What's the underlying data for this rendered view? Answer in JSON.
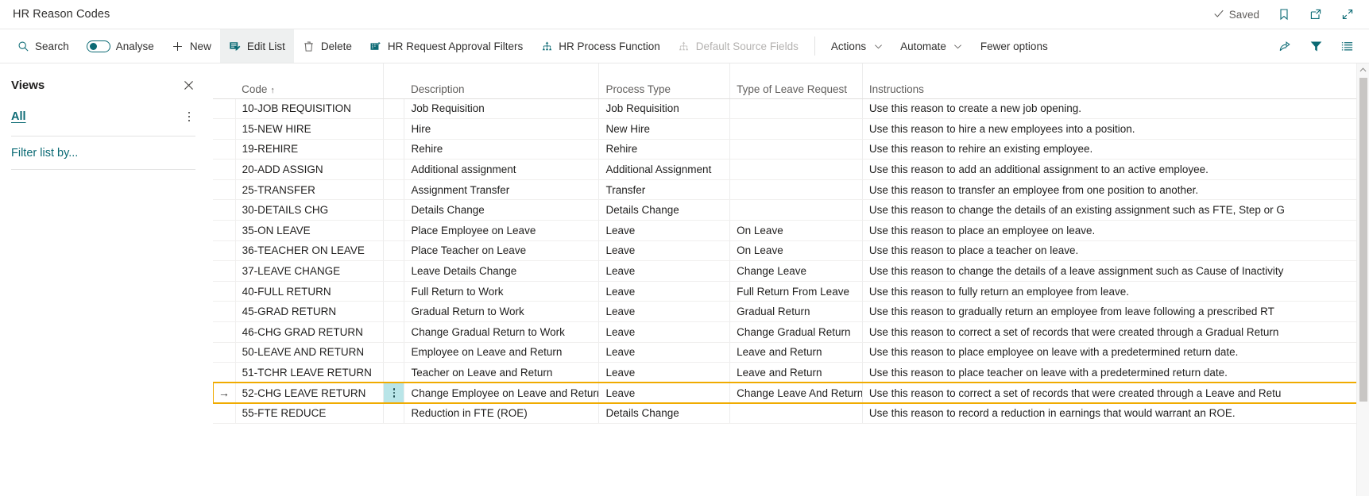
{
  "window": {
    "title": "HR Reason Codes",
    "save_status": "Saved",
    "icons": {
      "check": "check-icon",
      "bookmark": "bookmark-icon",
      "open_in_new": "open-in-new-window-icon",
      "collapse": "collapse-icon"
    }
  },
  "toolbar": {
    "search_label": "Search",
    "analyse_label": "Analyse",
    "analyse_on": true,
    "new_label": "New",
    "edit_list_label": "Edit List",
    "delete_label": "Delete",
    "hr_request_approval_filters_label": "HR Request Approval Filters",
    "hr_process_function_label": "HR Process Function",
    "default_source_fields_label": "Default Source Fields",
    "default_source_fields_disabled": true,
    "actions_label": "Actions",
    "automate_label": "Automate",
    "fewer_options_label": "Fewer options",
    "right_icons": {
      "share": "share-icon",
      "filter": "filter-icon",
      "list": "list-view-icon"
    }
  },
  "views_pane": {
    "title": "Views",
    "close_icon": "close-icon",
    "active_view": "All",
    "more_icon": "more-options-icon",
    "filter_placeholder": "Filter list by..."
  },
  "grid": {
    "columns": [
      {
        "key": "code",
        "label": "Code",
        "sort": "↑"
      },
      {
        "key": "description",
        "label": "Description",
        "sort": ""
      },
      {
        "key": "process_type",
        "label": "Process Type",
        "sort": ""
      },
      {
        "key": "type_of_leave_request",
        "label": "Type of Leave Request",
        "sort": ""
      },
      {
        "key": "instructions",
        "label": "Instructions",
        "sort": ""
      }
    ],
    "selected_row_index": 14,
    "selected_row_indicator": "→",
    "row_menu_icon": "row-options-icon",
    "rows": [
      {
        "code": "10-JOB REQUISITION",
        "description": "Job Requisition",
        "process_type": "Job Requisition",
        "type_of_leave_request": "",
        "instructions": "Use this reason to create a new job opening."
      },
      {
        "code": "15-NEW HIRE",
        "description": "Hire",
        "process_type": "New Hire",
        "type_of_leave_request": "",
        "instructions": "Use this reason to hire a new employees into a position."
      },
      {
        "code": "19-REHIRE",
        "description": "Rehire",
        "process_type": "Rehire",
        "type_of_leave_request": "",
        "instructions": "Use this reason to rehire an existing employee."
      },
      {
        "code": "20-ADD ASSIGN",
        "description": "Additional assignment",
        "process_type": "Additional Assignment",
        "type_of_leave_request": "",
        "instructions": "Use this reason to add an additional assignment to an active employee."
      },
      {
        "code": "25-TRANSFER",
        "description": "Assignment Transfer",
        "process_type": "Transfer",
        "type_of_leave_request": "",
        "instructions": "Use this reason to transfer an employee from one position to another."
      },
      {
        "code": "30-DETAILS CHG",
        "description": "Details Change",
        "process_type": "Details Change",
        "type_of_leave_request": "",
        "instructions": "Use this reason to change the details of an existing assignment such as FTE, Step or G"
      },
      {
        "code": "35-ON LEAVE",
        "description": "Place Employee on Leave",
        "process_type": "Leave",
        "type_of_leave_request": "On Leave",
        "instructions": "Use this reason to place an employee on leave."
      },
      {
        "code": "36-TEACHER ON LEAVE",
        "description": "Place Teacher on Leave",
        "process_type": "Leave",
        "type_of_leave_request": "On Leave",
        "instructions": "Use this reason to place a teacher on leave."
      },
      {
        "code": "37-LEAVE CHANGE",
        "description": "Leave Details Change",
        "process_type": "Leave",
        "type_of_leave_request": "Change Leave",
        "instructions": "Use this reason to change the details of a leave assignment such as Cause of Inactivity"
      },
      {
        "code": "40-FULL RETURN",
        "description": "Full Return to Work",
        "process_type": "Leave",
        "type_of_leave_request": "Full Return From Leave",
        "instructions": "Use this reason to fully return an employee from leave."
      },
      {
        "code": "45-GRAD RETURN",
        "description": "Gradual Return to Work",
        "process_type": "Leave",
        "type_of_leave_request": "Gradual Return",
        "instructions": "Use this reason to gradually return an employee from leave following a prescribed RT"
      },
      {
        "code": "46-CHG GRAD RETURN",
        "description": "Change Gradual Return to Work",
        "process_type": "Leave",
        "type_of_leave_request": "Change Gradual Return",
        "instructions": "Use this reason to correct a set of records that were created through a Gradual Return"
      },
      {
        "code": "50-LEAVE AND RETURN",
        "description": "Employee on Leave and Return",
        "process_type": "Leave",
        "type_of_leave_request": "Leave and Return",
        "instructions": "Use this reason to place employee on leave with a predetermined return date."
      },
      {
        "code": "51-TCHR LEAVE RETURN",
        "description": "Teacher on Leave and Return",
        "process_type": "Leave",
        "type_of_leave_request": "Leave and Return",
        "instructions": "Use this reason to place teacher on leave with a predetermined return date."
      },
      {
        "code": "52-CHG LEAVE RETURN",
        "description": "Change Employee on Leave and Return",
        "process_type": "Leave",
        "type_of_leave_request": "Change Leave And Return",
        "instructions": "Use this reason to correct a set of records that were created through a Leave and Retu"
      },
      {
        "code": "55-FTE REDUCE",
        "description": "Reduction in FTE (ROE)",
        "process_type": "Details Change",
        "type_of_leave_request": "",
        "instructions": "Use this reason to record a reduction in earnings that would warrant an ROE."
      }
    ]
  },
  "colors": {
    "accent": "#0b6a74",
    "selection_border": "#f0ab00",
    "selection_cell": "#b9e5e8"
  }
}
